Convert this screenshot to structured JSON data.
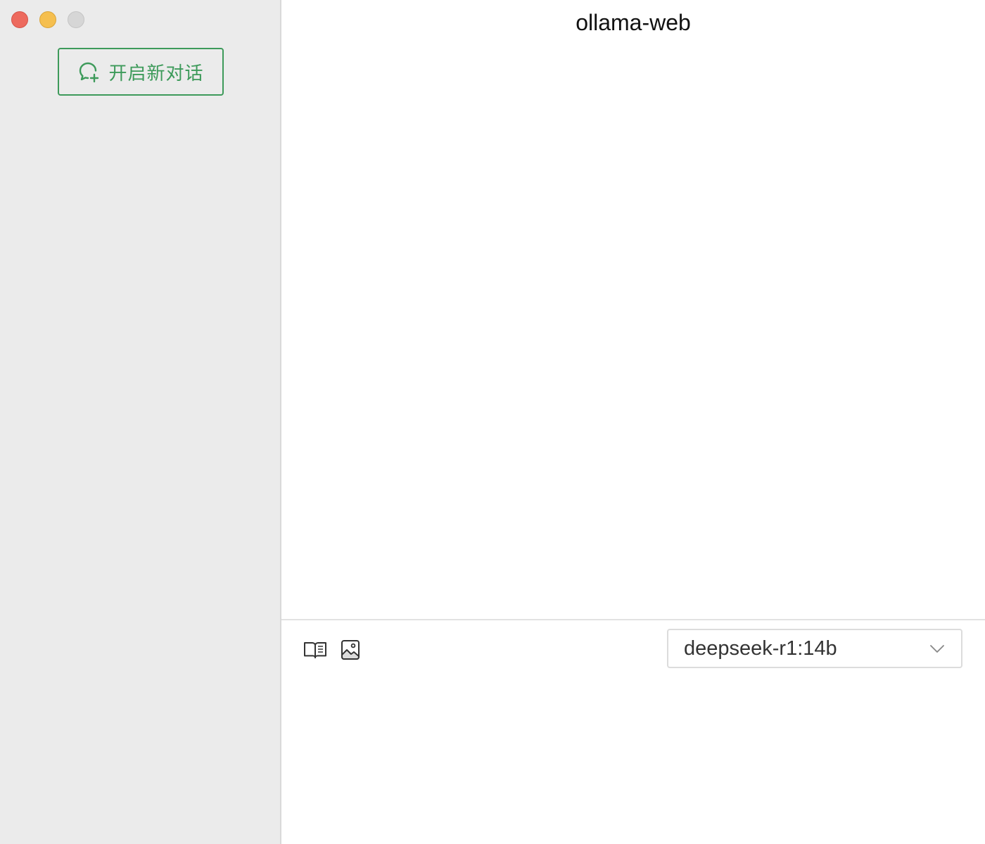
{
  "window": {
    "title": "ollama-web"
  },
  "sidebar": {
    "new_chat_label": "开启新对话",
    "new_chat_icon": "chat-plus-icon"
  },
  "composer": {
    "tools": [
      {
        "icon": "book-icon"
      },
      {
        "icon": "image-icon"
      }
    ],
    "model": {
      "selected": "deepseek-r1:14b"
    },
    "input": {
      "value": "",
      "placeholder": ""
    }
  },
  "colors": {
    "accent": "#3d9a5a",
    "sidebar_bg": "#ebebeb",
    "close": "#ed6a5e",
    "minimize": "#f5bf4f",
    "zoom_inactive": "#d6d6d6"
  }
}
